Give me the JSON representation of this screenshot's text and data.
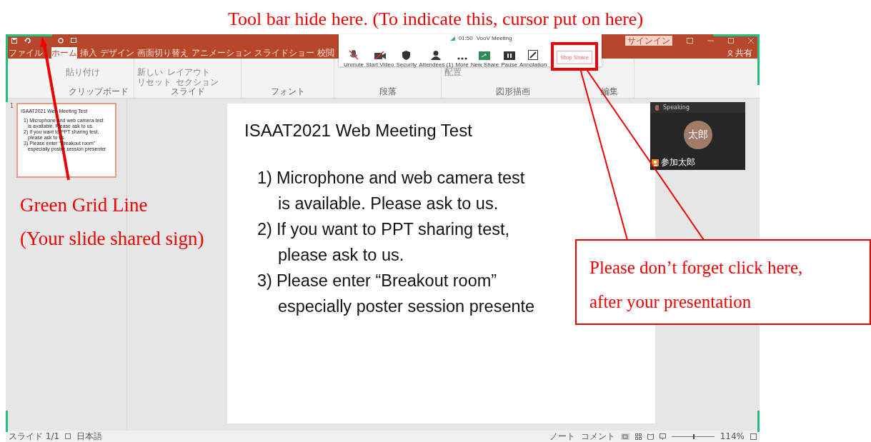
{
  "annotations": {
    "top": "Tool bar hide here. (To indicate this, cursor put on here)",
    "left": [
      "Green Grid Line",
      "(Your slide shared sign)"
    ],
    "callout": [
      "Please don’t forget click here,",
      "after your presentation"
    ]
  },
  "window": {
    "signin": "サインイン",
    "share": "共有"
  },
  "tabs": [
    {
      "label": "ファイル",
      "selected": false
    },
    {
      "label": "ホーム",
      "selected": true
    },
    {
      "label": "挿入",
      "selected": false
    },
    {
      "label": "デザイン",
      "selected": false
    },
    {
      "label": "画面切り替え",
      "selected": false
    },
    {
      "label": "アニメーション",
      "selected": false
    },
    {
      "label": "スライドショー",
      "selected": false
    },
    {
      "label": "校閲",
      "selected": false
    }
  ],
  "ribbon": [
    {
      "label": "クリップボード",
      "buttons": [
        "貼り付け"
      ]
    },
    {
      "label": "スライド",
      "buttons": [
        "新しい",
        "レイアウト",
        "リセット",
        "セクション"
      ]
    },
    {
      "label": "フォント"
    },
    {
      "label": "段落"
    },
    {
      "label": "図形描画",
      "buttons": [
        "配置"
      ]
    },
    {
      "label": "編集"
    }
  ],
  "meeting_toolbar": {
    "timer": "01:50",
    "title": "VooV Meeting",
    "buttons": [
      {
        "label": "Unmute",
        "kind": "mic"
      },
      {
        "label": "Start Video",
        "kind": "video"
      },
      {
        "label": "Security",
        "kind": "shield"
      },
      {
        "label": "Attendees (1)",
        "kind": "person"
      },
      {
        "label": "More",
        "kind": "dots"
      },
      {
        "label": "New Share",
        "kind": "share"
      },
      {
        "label": "Pause",
        "kind": "pause"
      },
      {
        "label": "Annotation",
        "kind": "pen"
      }
    ],
    "stop": "Stop Share"
  },
  "thumbnail": {
    "number": "1",
    "selected": true,
    "title": "ISAAT2021 Web Meeting Test",
    "items": [
      [
        "1) Microphone and web camera test",
        "is available. Please ask to us."
      ],
      [
        "2) If you want to PPT sharing test,",
        "please ask to us."
      ],
      [
        "3) Please enter “Breakout room”",
        "especially poster session presenter"
      ]
    ]
  },
  "slide": {
    "title": "ISAAT2021 Web Meeting Test",
    "items": [
      [
        "1)",
        "Microphone and web camera test",
        "is available. Please ask to us."
      ],
      [
        "2)",
        "If you want to PPT sharing test,",
        "please ask to us."
      ],
      [
        "3)",
        "Please enter “Breakout room”",
        "especially poster session presente"
      ]
    ]
  },
  "video": {
    "status": "Speaking",
    "avatar": "太郎",
    "name": "参加太郎"
  },
  "status_bar": {
    "left": [
      "スライド 1/1",
      "日本語"
    ],
    "right": [
      "ノート",
      "コメント"
    ],
    "zoom": "114%",
    "level": 0.5
  }
}
